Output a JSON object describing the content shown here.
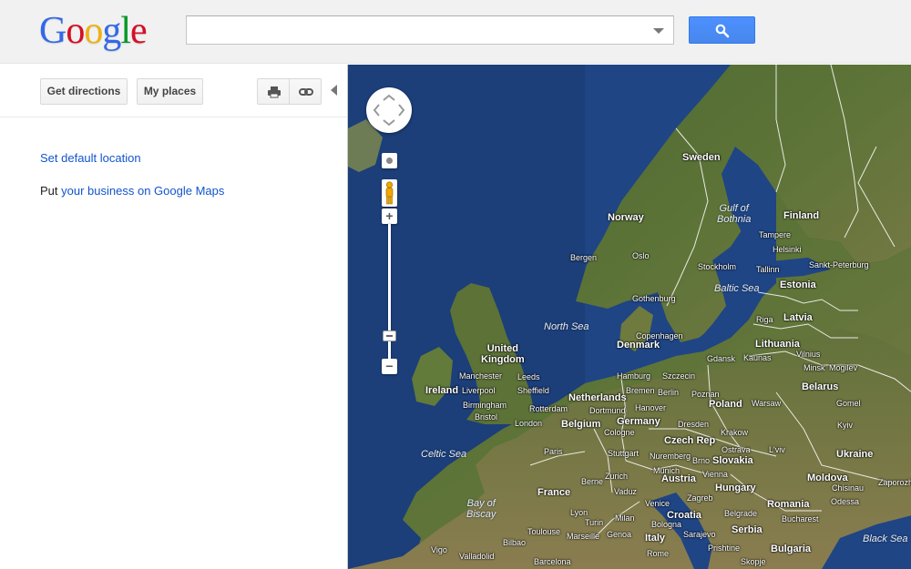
{
  "header": {
    "logo_letters": [
      {
        "ch": "G",
        "color": "#3369e8"
      },
      {
        "ch": "o",
        "color": "#d50f25"
      },
      {
        "ch": "o",
        "color": "#eeb211"
      },
      {
        "ch": "g",
        "color": "#3369e8"
      },
      {
        "ch": "l",
        "color": "#009925"
      },
      {
        "ch": "e",
        "color": "#d50f25"
      }
    ],
    "search_value": "",
    "search_icon": "magnifier-icon"
  },
  "toolbar": {
    "directions_label": "Get directions",
    "places_label": "My places",
    "print_icon": "print-icon",
    "link_icon": "link-icon"
  },
  "panel": {
    "default_location_link": "Set default location",
    "business_prefix": "Put",
    "business_link": "your business on Google Maps"
  },
  "map": {
    "labels": {
      "sweden": "Sweden",
      "norway": "Norway",
      "finland": "Finland",
      "gulf_bothnia": "Gulf of\nBothnia",
      "tampere": "Tampere",
      "helsinki": "Helsinki",
      "st_petersburg": "Sankt-Peterburg",
      "bergen": "Bergen",
      "oslo": "Oslo",
      "stockholm": "Stockholm",
      "tallinn": "Tallinn",
      "estonia": "Estonia",
      "gothenburg": "Gothenburg",
      "baltic_sea": "Baltic Sea",
      "riga": "Riga",
      "latvia": "Latvia",
      "north_sea": "North Sea",
      "copenhagen": "Copenhagen",
      "denmark": "Denmark",
      "united_kingdom": "United\nKingdom",
      "lithuania": "Lithuania",
      "gdansk": "Gdansk",
      "kaunas": "Kaunas",
      "vilnius": "Vilnius",
      "manchester": "Manchester",
      "leeds": "Leeds",
      "minsk": "Minsk",
      "mogilev": "Mogilev",
      "ireland": "Ireland",
      "liverpool": "Liverpool",
      "sheffield": "Sheffield",
      "hamburg": "Hamburg",
      "szczecin": "Szczecin",
      "bremen": "Bremen",
      "berlin": "Berlin",
      "poznan": "Poznan",
      "belarus": "Belarus",
      "birmingham": "Birmingham",
      "netherlands": "Netherlands",
      "hanover": "Hanover",
      "poland": "Poland",
      "warsaw": "Warsaw",
      "gomel": "Gomel",
      "rotterdam": "Rotterdam",
      "dortmund": "Dortmund",
      "bristol": "Bristol",
      "london": "London",
      "belgium": "Belgium",
      "germany": "Germany",
      "dresden": "Dresden",
      "kyiv": "Kyiv",
      "cologne": "Cologne",
      "krakow": "Krakow",
      "czech_rep": "Czech Rep",
      "ostrava": "Ostrava",
      "lviv": "L'viv",
      "celtic_sea": "Celtic Sea",
      "paris": "Paris",
      "stuttgart": "Stuttgart",
      "nuremberg": "Nuremberg",
      "brno": "Brno",
      "slovakia": "Slovakia",
      "ukraine": "Ukraine",
      "munich": "Munich",
      "vienna": "Vienna",
      "zurich": "Zurich",
      "austria": "Austria",
      "bern": "Berne",
      "hungary": "Hungary",
      "moldova": "Moldova",
      "zaporozhye": "Zaporozhy",
      "chisinau": "Chisinau",
      "france": "France",
      "vaduz": "Vaduz",
      "zagreb": "Zagreb",
      "odessa": "Odessa",
      "bay_biscay": "Bay of\nBiscay",
      "lyon": "Lyon",
      "milan": "Milan",
      "venice": "Venice",
      "croatia": "Croatia",
      "romania": "Romania",
      "belgrade": "Belgrade",
      "turin": "Turin",
      "bologna": "Bologna",
      "bucharest": "Bucharest",
      "toulouse": "Toulouse",
      "marseille": "Marseille",
      "genoa": "Genoa",
      "sarajevo": "Sarajevo",
      "serbia": "Serbia",
      "bilbao": "Bilbao",
      "vigo": "Vigo",
      "italy": "Italy",
      "pristina": "Prishtine",
      "bulgaria": "Bulgaria",
      "black_sea": "Black Sea",
      "valladolid": "Valladolid",
      "barcelona": "Barcelona",
      "rome": "Rome",
      "skopje": "Skopje"
    }
  }
}
